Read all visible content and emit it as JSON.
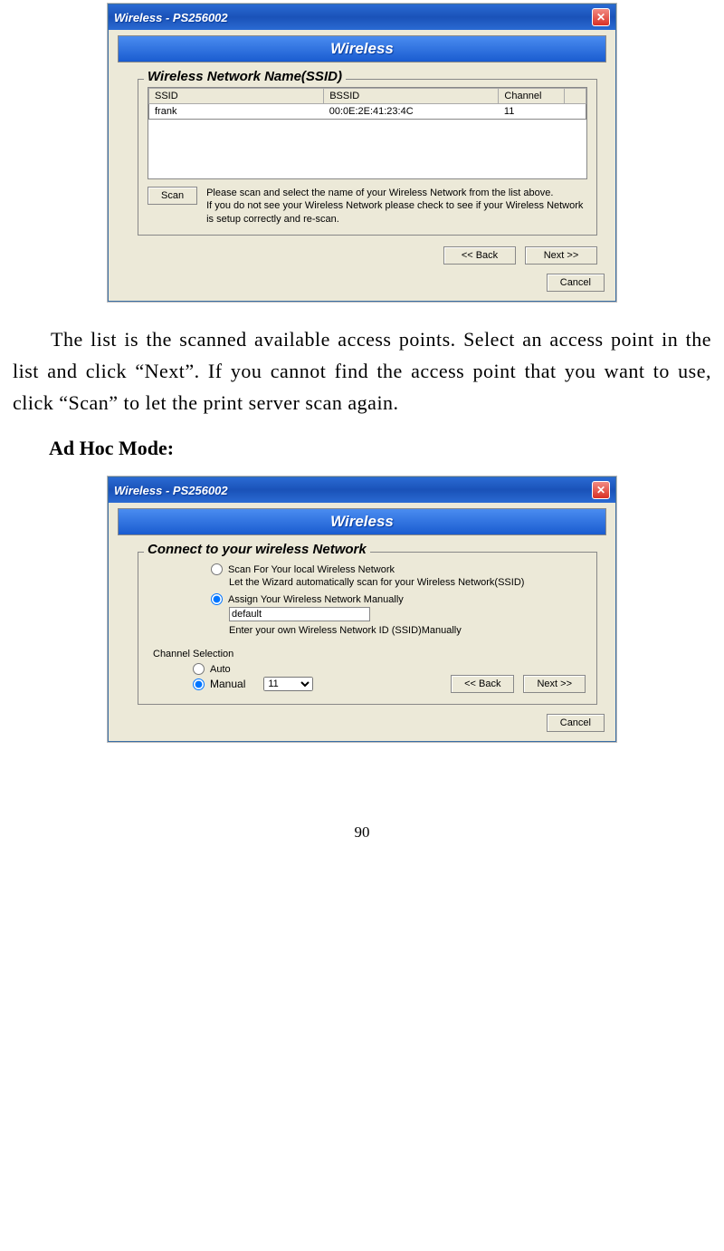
{
  "dialog1": {
    "title": "Wireless - PS256002",
    "banner": "Wireless",
    "group_title": "Wireless Network Name(SSID)",
    "cols": {
      "ssid": "SSID",
      "bssid": "BSSID",
      "channel": "Channel"
    },
    "row": {
      "ssid": "frank",
      "bssid": "00:0E:2E:41:23:4C",
      "channel": "11"
    },
    "scan_btn": "Scan",
    "help1": "Please scan and select the name of your Wireless Network from the list above.",
    "help2": "If you do not see your Wireless Network please check to see if your Wireless Network is setup correctly and re-scan.",
    "back": "<< Back",
    "next": "Next >>",
    "cancel": "Cancel"
  },
  "paragraph1": "The list is the scanned available access points. Select an access point in the list and click “Next”. If you cannot find the access point that you want to use, click “Scan” to let the print server scan again.",
  "heading": "Ad Hoc Mode:",
  "dialog2": {
    "title": "Wireless - PS256002",
    "banner": "Wireless",
    "group_title": "Connect to your wireless Network",
    "opt1": "Scan For Your local Wireless Network",
    "opt1_sub": "Let the Wizard automatically scan for your Wireless Network(SSID)",
    "opt2": "Assign Your Wireless Network Manually",
    "ssid_value": "default",
    "opt2_sub": "Enter your own Wireless Network ID (SSID)Manually",
    "channel_label": "Channel Selection",
    "ch_auto": "Auto",
    "ch_manual": "Manual",
    "ch_value": "11",
    "back": "<< Back",
    "next": "Next >>",
    "cancel": "Cancel"
  },
  "page_number": "90"
}
